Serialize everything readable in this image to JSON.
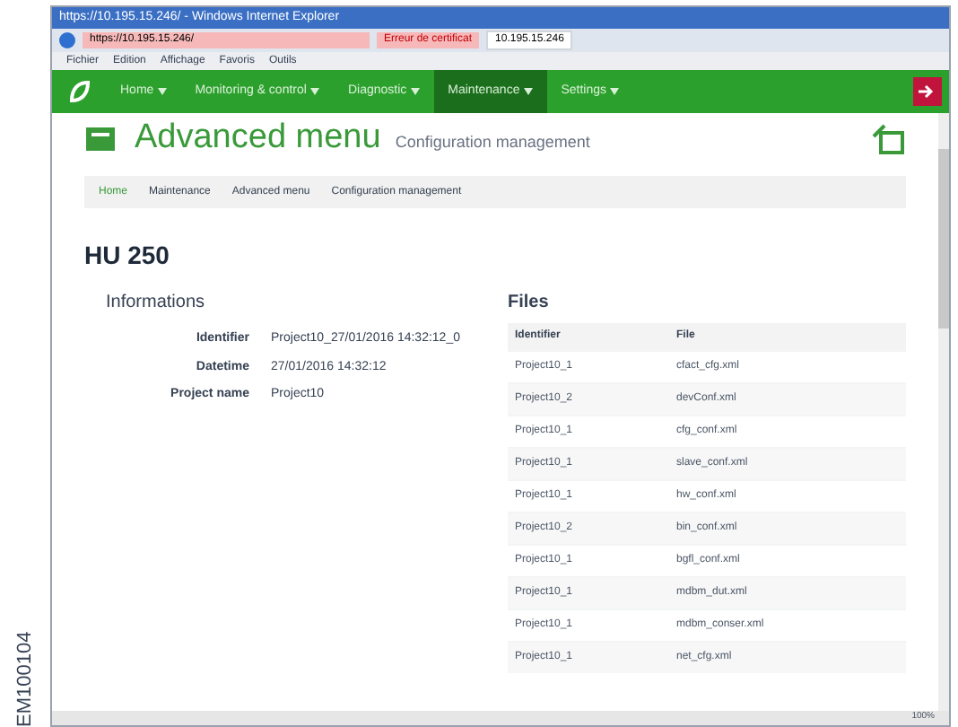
{
  "side_label": "EM100104",
  "browser": {
    "title": "https://10.195.15.246/ - Windows Internet Explorer",
    "address": "https://10.195.15.246/",
    "cert_error": "Erreur de certificat",
    "tab": "10.195.15.246",
    "menu": [
      "Fichier",
      "Edition",
      "Affichage",
      "Favoris",
      "Outils"
    ],
    "zoom": "100%"
  },
  "nav": [
    {
      "label": "Home",
      "selected": false
    },
    {
      "label": "Monitoring & control",
      "selected": false
    },
    {
      "label": "Diagnostic",
      "selected": false
    },
    {
      "label": "Maintenance",
      "selected": true
    },
    {
      "label": "Settings",
      "selected": false
    }
  ],
  "header": {
    "title": "Advanced menu",
    "subtitle": "Configuration management"
  },
  "breadcrumb": [
    "Home",
    "Maintenance",
    "Advanced menu",
    "Configuration management"
  ],
  "device": "HU 250",
  "informations": {
    "title": "Informations",
    "rows": [
      {
        "label": "Identifier",
        "value": "Project10_27/01/2016 14:32:12_0"
      },
      {
        "label": "Datetime",
        "value": "27/01/2016 14:32:12"
      },
      {
        "label": "Project name",
        "value": "Project10"
      }
    ]
  },
  "files": {
    "title": "Files",
    "columns": [
      "Identifier",
      "File"
    ],
    "rows": [
      [
        "Project10_1",
        "cfact_cfg.xml"
      ],
      [
        "Project10_2",
        "devConf.xml"
      ],
      [
        "Project10_1",
        "cfg_conf.xml"
      ],
      [
        "Project10_1",
        "slave_conf.xml"
      ],
      [
        "Project10_1",
        "hw_conf.xml"
      ],
      [
        "Project10_2",
        "bin_conf.xml"
      ],
      [
        "Project10_1",
        "bgfl_conf.xml"
      ],
      [
        "Project10_1",
        "mdbm_dut.xml"
      ],
      [
        "Project10_1",
        "mdbm_conser.xml"
      ],
      [
        "Project10_1",
        "net_cfg.xml"
      ]
    ]
  }
}
